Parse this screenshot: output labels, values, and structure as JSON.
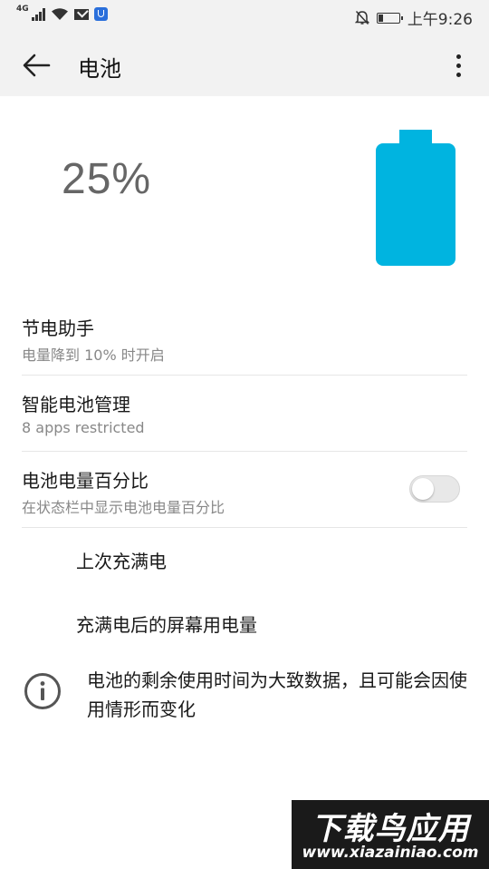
{
  "status_bar": {
    "network": "4G",
    "time": "上午9:26",
    "battery_level": 0.25,
    "icons": [
      "signal-icon",
      "wifi-icon",
      "mail-icon",
      "shield-app-icon",
      "mute-bell-icon",
      "battery-icon"
    ]
  },
  "app_bar": {
    "title": "电池",
    "back_icon": "arrow-left-icon",
    "more_icon": "more-vertical-icon"
  },
  "battery": {
    "percent_label": "25%",
    "level": 0.25,
    "color": "#00b4e0"
  },
  "settings": [
    {
      "title": "节电助手",
      "subtitle": "电量降到 10% 时开启"
    },
    {
      "title": "智能电池管理",
      "subtitle": "8 apps restricted"
    },
    {
      "title": "电池电量百分比",
      "subtitle": "在状态栏中显示电池电量百分比",
      "toggle_on": false
    }
  ],
  "sections": {
    "last_full_charge": "上次充满电",
    "screen_usage": "充满电后的屏幕用电量"
  },
  "info": {
    "icon": "info-icon",
    "text": "电池的剩余使用时间为大致数据，且可能会因使用情形而变化"
  },
  "watermark": {
    "brand": "下载鸟应用",
    "url": "www.xiazainiao.com"
  }
}
